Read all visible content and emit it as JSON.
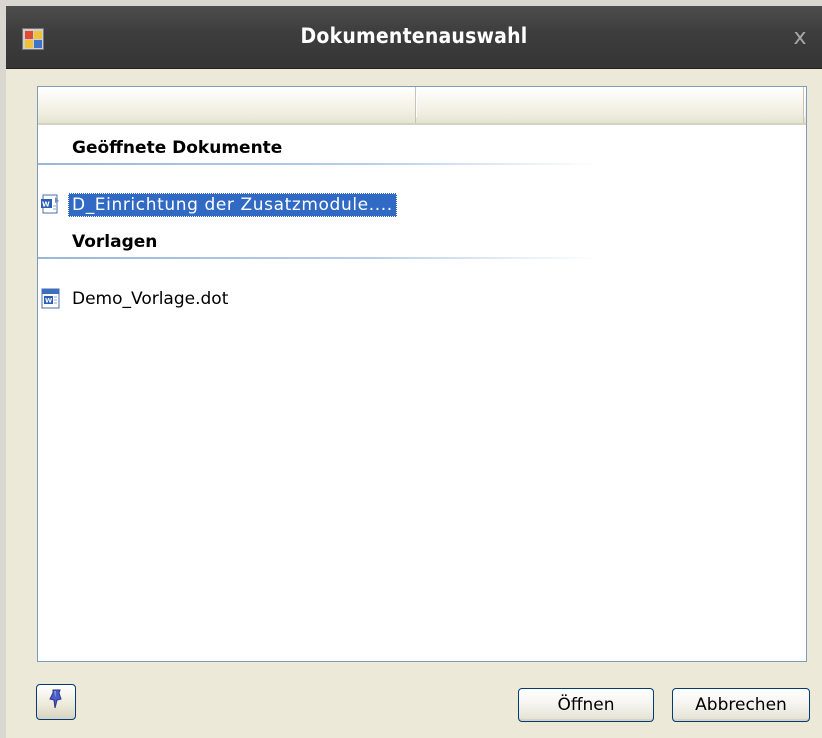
{
  "window": {
    "title": "Dokumentenauswahl",
    "close_glyph": "x",
    "app_icon": "app-window-icon"
  },
  "listview": {
    "columns": [
      "",
      ""
    ],
    "groups": [
      {
        "header": "Geöffnete Dokumente",
        "items": [
          {
            "label": "D_Einrichtung der Zusatzmodule....",
            "icon": "word-document-icon",
            "selected": true
          }
        ]
      },
      {
        "header": "Vorlagen",
        "items": [
          {
            "label": "Demo_Vorlage.dot",
            "icon": "word-template-icon",
            "selected": false
          }
        ]
      }
    ]
  },
  "buttons": {
    "pin_icon": "pushpin-icon",
    "open_label": "Öffnen",
    "cancel_label": "Abbrechen"
  },
  "colors": {
    "selection": "#316ac5",
    "titlebar": "#3e3e3e",
    "group_line": "#9ab7d9",
    "button_border": "#003c74"
  }
}
